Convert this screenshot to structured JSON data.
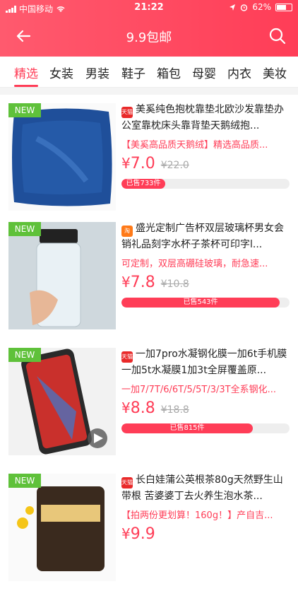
{
  "status": {
    "carrier": "中国移动",
    "time": "21:22",
    "battery": "62%"
  },
  "nav": {
    "title": "9.9包邮"
  },
  "tabs": [
    "精选",
    "女装",
    "男装",
    "鞋子",
    "箱包",
    "母婴",
    "内衣",
    "美妆"
  ],
  "colors": {
    "accent": "#ff3d57",
    "new_badge": "#5fc13a"
  },
  "products": [
    {
      "badge": "NEW",
      "source": "天猫",
      "title": "美奚纯色抱枕靠垫北欧沙发靠垫办公室靠枕床头靠背垫天鹅绒抱...",
      "desc": "【美奚高品质天鹅绒】精选高品质...",
      "currency": "¥",
      "price": "7.0",
      "old_price": "¥22.0",
      "sold": "已售733件",
      "sold_ratio": 0.26
    },
    {
      "badge": "NEW",
      "source": "淘",
      "title": "盛光定制广告杯双层玻璃杯男女会销礼品刻字水杯子茶杯可印字l...",
      "desc": "可定制，双层高硼硅玻璃，耐急速...",
      "currency": "¥",
      "price": "7.8",
      "old_price": "¥10.8",
      "sold": "已售543件",
      "sold_ratio": 0.94
    },
    {
      "badge": "NEW",
      "source": "天猫",
      "title": "一加7pro水凝钢化膜一加6t手机膜一加5t水凝膜1加3t全屏覆盖原...",
      "desc": "一加7/7T/6/6T/5/5T/3/3T全系钢化...",
      "currency": "¥",
      "price": "8.8",
      "old_price": "¥18.8",
      "sold": "已售815件",
      "sold_ratio": 0.78
    },
    {
      "badge": "NEW",
      "source": "天猫",
      "title": "长白娃蒲公英根茶80g天然野生山带根 苦婆婆丁去火养生泡水茶...",
      "desc": "【拍两份更划算！160g！】产自吉...",
      "currency": "¥",
      "price": "9.9",
      "old_price": "",
      "sold": "",
      "sold_ratio": 0.5
    }
  ]
}
